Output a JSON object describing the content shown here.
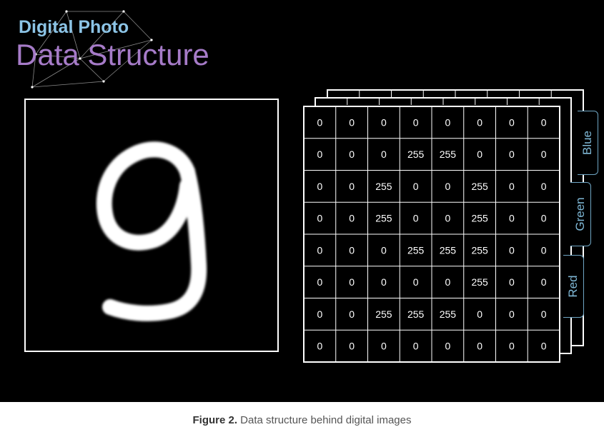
{
  "title": {
    "line1": "Digital Photo",
    "line2": "Data Structure"
  },
  "grid": {
    "rows": [
      [
        0,
        0,
        0,
        0,
        0,
        0,
        0,
        0
      ],
      [
        0,
        0,
        0,
        255,
        255,
        0,
        0,
        0
      ],
      [
        0,
        0,
        255,
        0,
        0,
        255,
        0,
        0
      ],
      [
        0,
        0,
        255,
        0,
        0,
        255,
        0,
        0
      ],
      [
        0,
        0,
        0,
        255,
        255,
        255,
        0,
        0
      ],
      [
        0,
        0,
        0,
        0,
        0,
        255,
        0,
        0
      ],
      [
        0,
        0,
        255,
        255,
        255,
        0,
        0,
        0
      ],
      [
        0,
        0,
        0,
        0,
        0,
        0,
        0,
        0
      ]
    ]
  },
  "channels": [
    "Blue",
    "Green",
    "Red"
  ],
  "caption": {
    "label": "Figure 2.",
    "text": " Data structure behind digital images"
  },
  "colors": {
    "background": "#000000",
    "title_line1": "#8cc4e6",
    "title_line2": "#a67bc8",
    "channel_tab": "#7fb8d6"
  },
  "icons": {
    "network": "network-graph-icon",
    "digit": "handwritten-nine-image"
  }
}
